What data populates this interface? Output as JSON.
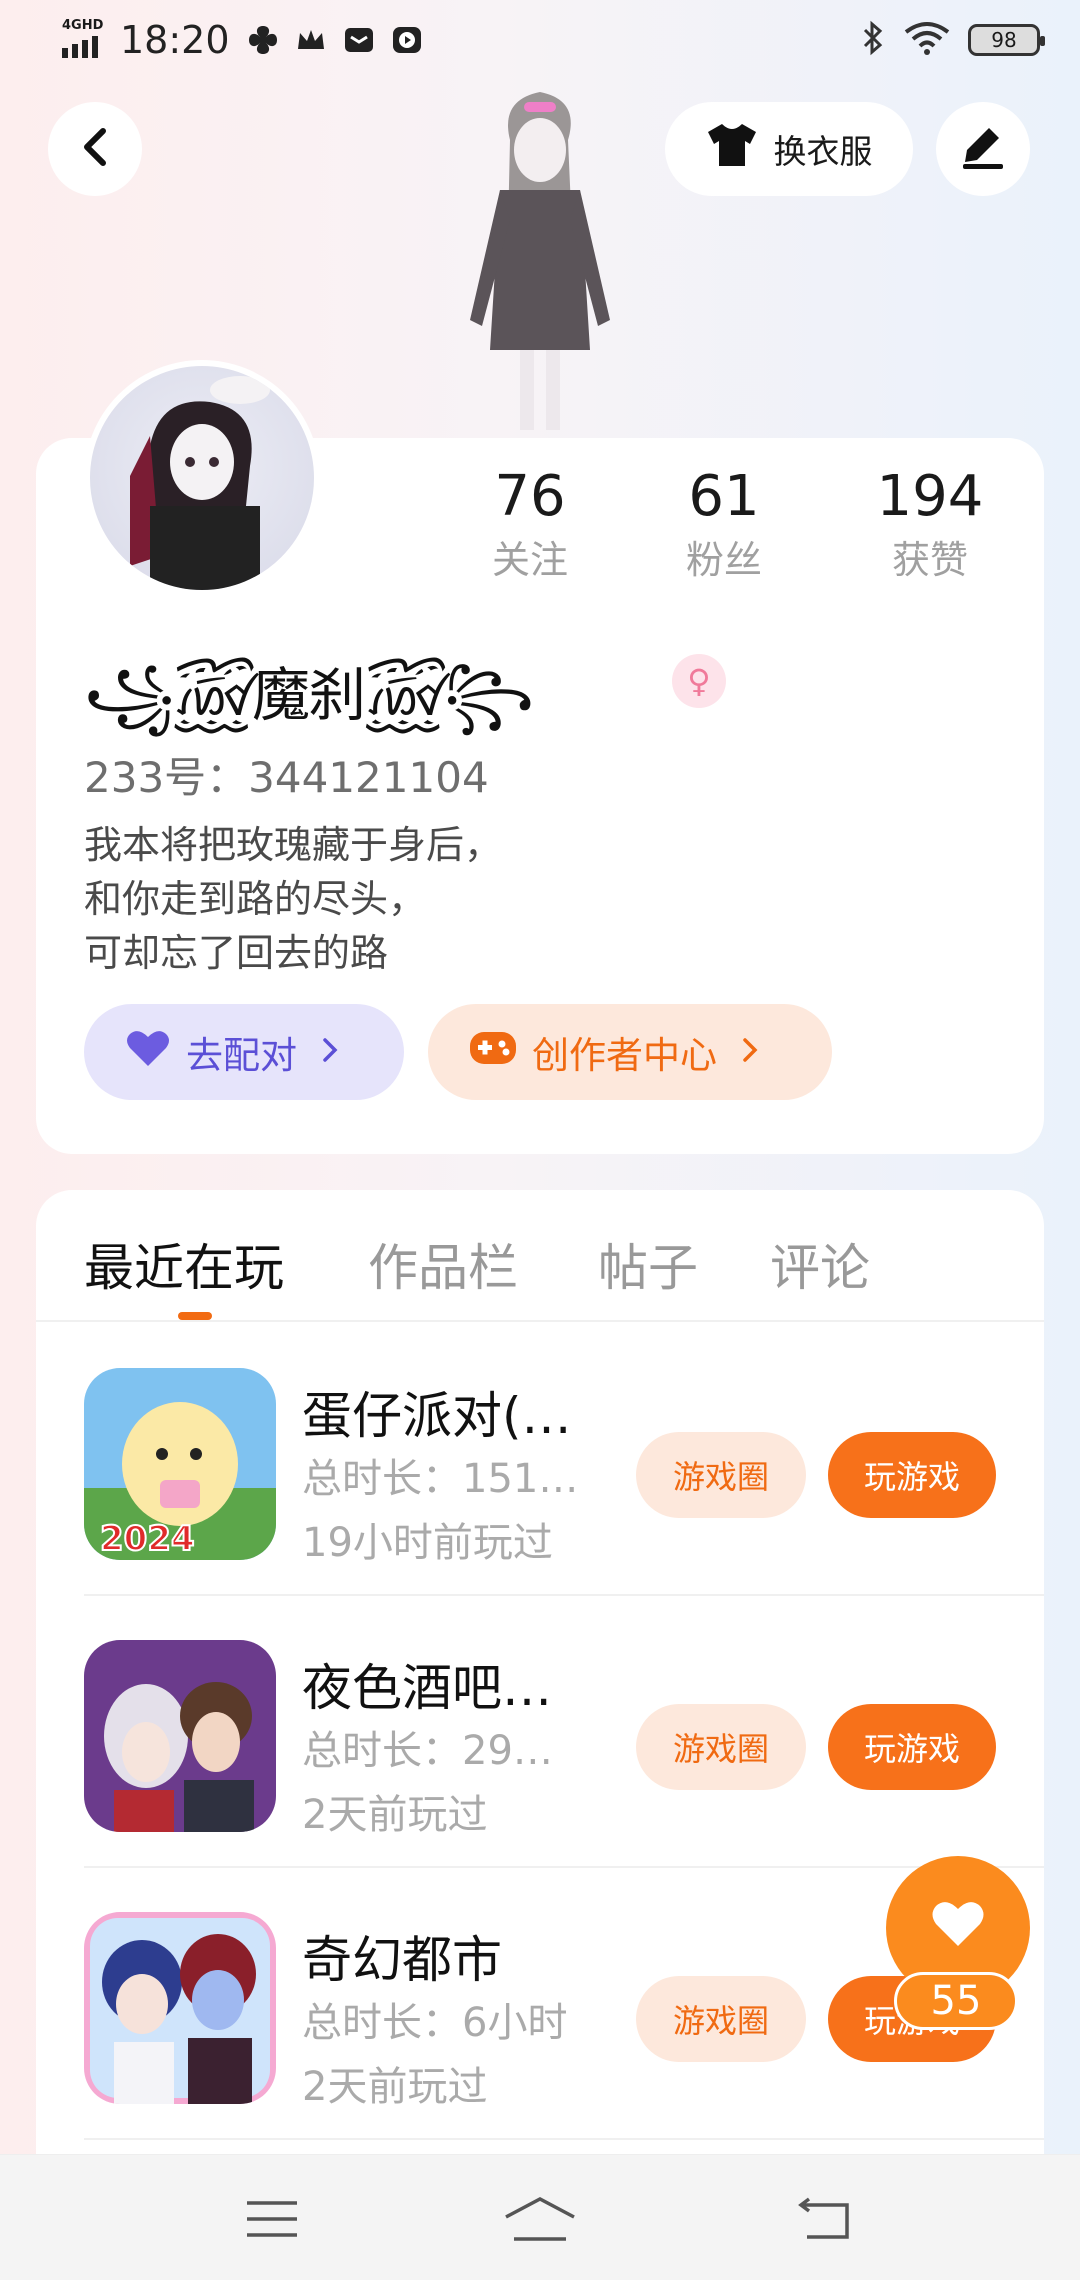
{
  "status_bar": {
    "network": "4GHD",
    "time": "18:20",
    "battery": "98"
  },
  "header": {
    "outfit_label": "换衣服"
  },
  "profile": {
    "stats": [
      {
        "value": "76",
        "label": "关注"
      },
      {
        "value": "61",
        "label": "粉丝"
      },
      {
        "value": "194",
        "label": "获赞"
      }
    ],
    "username": "꧁꫞魔刹꫞꧂",
    "gender_symbol": "♀",
    "uid": "233号：344121104",
    "bio": [
      "我本将把玫瑰藏于身后，",
      "和你走到路的尽头，",
      "可却忘了回去的路"
    ],
    "match_button": "去配对",
    "creator_button": "创作者中心"
  },
  "tabs": [
    "最近在玩",
    "作品栏",
    "帖子",
    "评论"
  ],
  "games": [
    {
      "name": "蛋仔派对(…",
      "duration": "总时长：151…",
      "last_played": "19小时前玩过",
      "circle_label": "游戏圈",
      "play_label": "玩游戏",
      "icon_text": "2024"
    },
    {
      "name": "夜色酒吧…",
      "duration": "总时长：29…",
      "last_played": "2天前玩过",
      "circle_label": "游戏圈",
      "play_label": "玩游戏"
    },
    {
      "name": "奇幻都市",
      "duration": "总时长：6小时",
      "last_played": "2天前玩过",
      "circle_label": "游戏圈",
      "play_label": "玩游戏"
    }
  ],
  "like_count": "55",
  "colors": {
    "accent": "#f7711a",
    "accent_soft": "#fde8dc",
    "match_purple": "#5b4fd6",
    "match_bg": "#e6e4fb"
  },
  "icons": {
    "back": "chevron-left-icon",
    "outfit": "tshirt-icon",
    "edit": "pen-icon",
    "heart": "heart-icon",
    "gamepad": "gamepad-icon",
    "nav": [
      "menu-icon",
      "home-icon",
      "back-arrow-icon"
    ]
  }
}
